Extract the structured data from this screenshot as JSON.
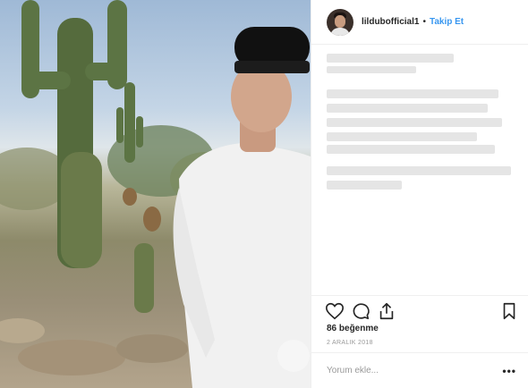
{
  "post": {
    "username": "lildubofficial1",
    "separator": "•",
    "follow_label": "Takip Et",
    "likes": "86 beğenme",
    "date": "2 ARALIK 2018",
    "comment_placeholder": "Yorum ekle...",
    "more_label": "•••",
    "caption_blurred": true
  },
  "icons": {
    "like": "heart-icon",
    "comment": "comment-bubble-icon",
    "share": "share-icon",
    "save": "bookmark-icon"
  },
  "colors": {
    "accent": "#3897f0",
    "text": "#262626",
    "muted": "#999999",
    "divider": "#efefef"
  }
}
